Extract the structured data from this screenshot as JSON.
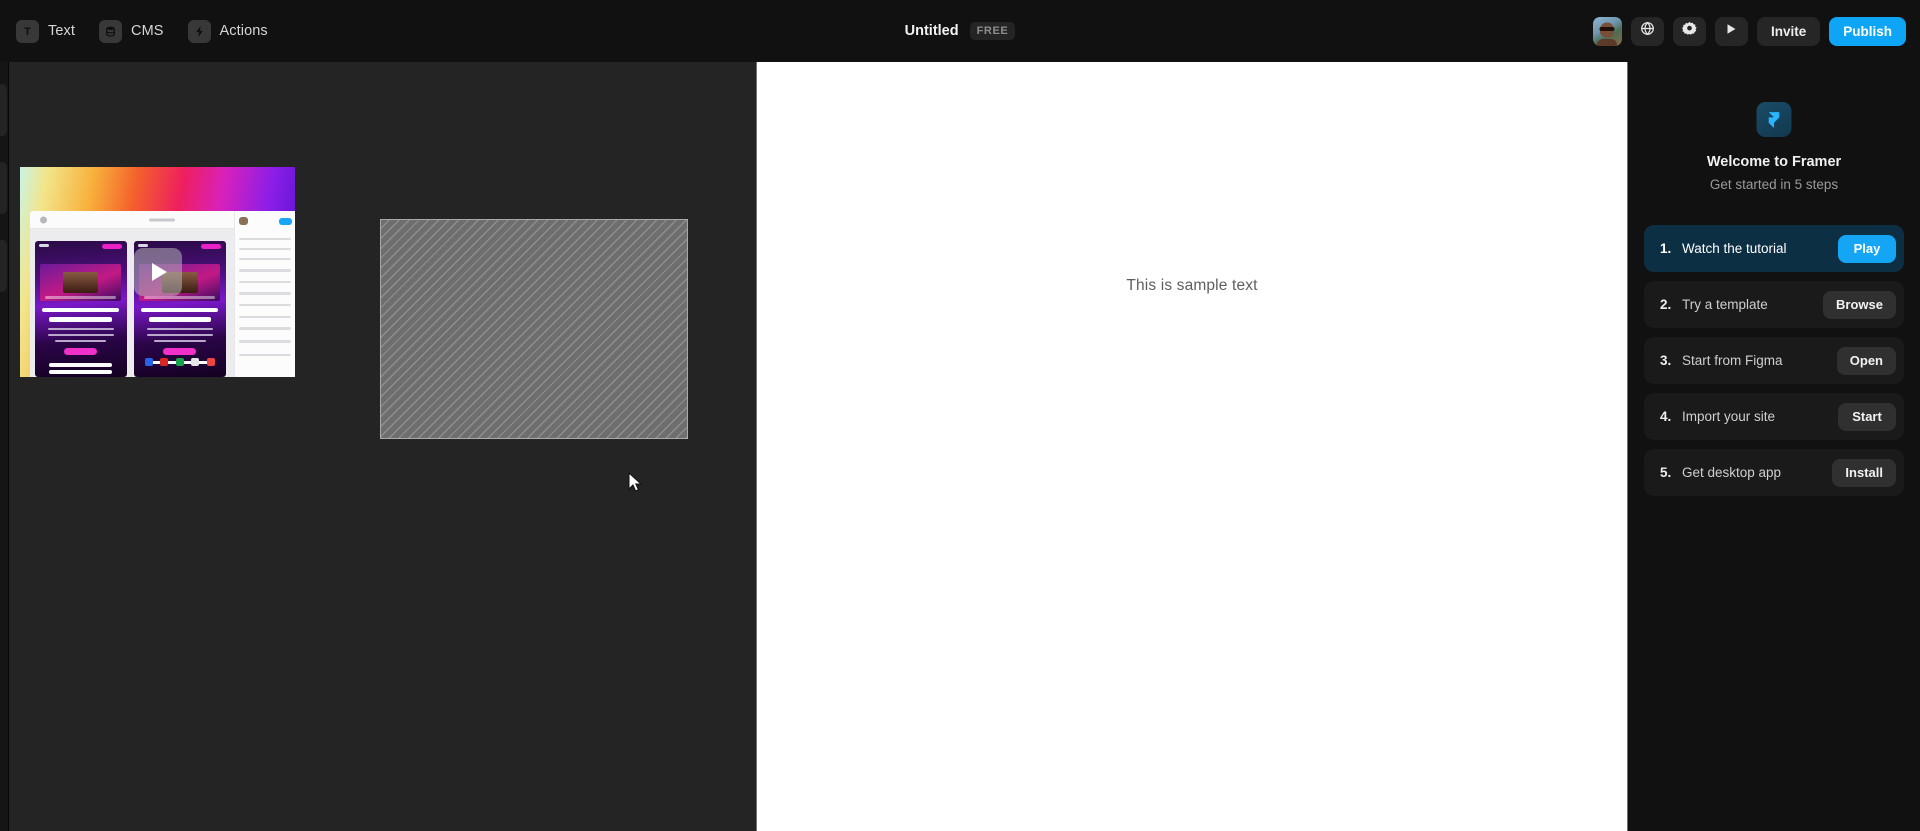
{
  "topbar": {
    "tools": [
      {
        "label": "Text",
        "icon": "text-icon"
      },
      {
        "label": "CMS",
        "icon": "database-icon"
      },
      {
        "label": "Actions",
        "icon": "bolt-icon"
      }
    ],
    "document_title": "Untitled",
    "plan_badge": "FREE",
    "actions": {
      "avatar": "user-avatar",
      "globe_icon": "globe-icon",
      "settings_icon": "gear-icon",
      "preview_icon": "play-icon",
      "invite_label": "Invite",
      "publish_label": "Publish"
    }
  },
  "canvas": {
    "video_card": {
      "name": "video-tutorial-thumbnail",
      "play_icon": "play-triangle-icon",
      "headline_1": "Cinematic video made simple",
      "headline_2": "Cinematic video made simple",
      "subline": "Overall works with the platforms you love"
    },
    "placeholder": {
      "name": "hatched-placeholder-rect"
    }
  },
  "page": {
    "sample_text": "This is sample text"
  },
  "right_panel": {
    "logo_icon": "framer-logo-icon",
    "title": "Welcome to Framer",
    "subtitle": "Get started in 5 steps",
    "steps": [
      {
        "number": "1.",
        "label": "Watch the tutorial",
        "action": "Play",
        "active": true
      },
      {
        "number": "2.",
        "label": "Try a template",
        "action": "Browse",
        "active": false
      },
      {
        "number": "3.",
        "label": "Start from Figma",
        "action": "Open",
        "active": false
      },
      {
        "number": "4.",
        "label": "Import your site",
        "action": "Start",
        "active": false
      },
      {
        "number": "5.",
        "label": "Get desktop app",
        "action": "Install",
        "active": false
      }
    ]
  },
  "colors": {
    "accent_blue": "#0ea5f7",
    "active_step_bg": "#0c2f44",
    "panel_bg": "#111111",
    "canvas_bg": "#242424"
  }
}
